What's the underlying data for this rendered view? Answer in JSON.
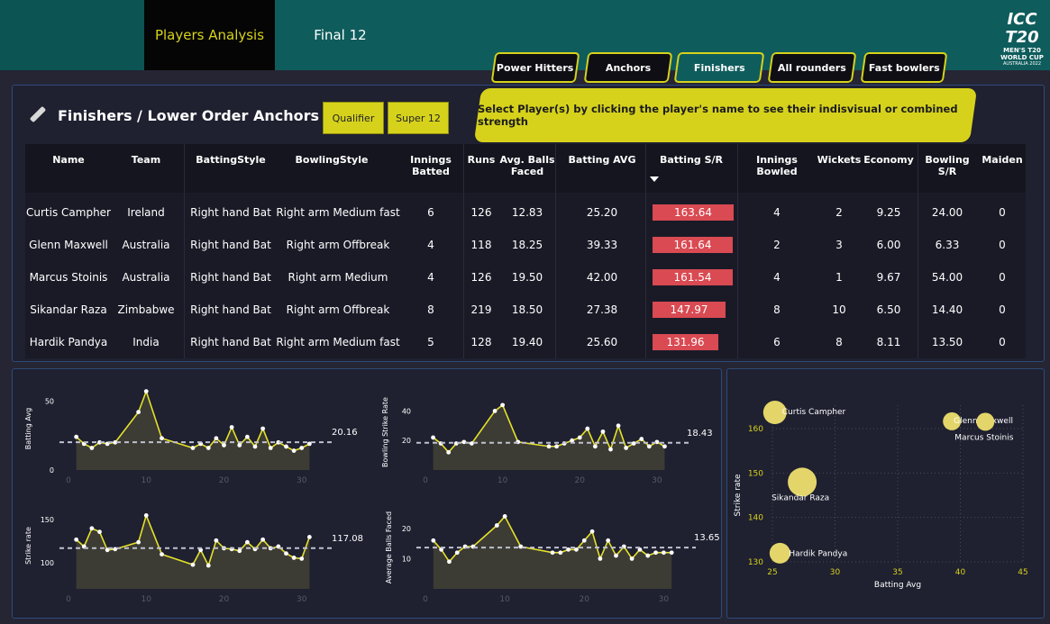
{
  "nav": {
    "tab_players": "Players Analysis",
    "tab_final": "Final 12"
  },
  "logo": {
    "top": "ICC T20",
    "line1": "MEN'S T20",
    "line2": "WORLD CUP",
    "line3": "AUSTRALIA 2022"
  },
  "categories": [
    "Power Hitters",
    "Anchors",
    "Finishers",
    "All rounders",
    "Fast bowlers"
  ],
  "active_category": "Finishers",
  "section_title": "Finishers / Lower Order Anchors",
  "stages": [
    "Qualifier",
    "Super 12"
  ],
  "banner": "Select Player(s) by clicking the player's name to see their indisvisual or combined strength",
  "table": {
    "headers": [
      "Name",
      "Team",
      "BattingStyle",
      "BowlingStyle",
      "Innings Batted",
      "Runs",
      "Avg. Balls Faced",
      "Batting AVG",
      "Batting S/R",
      "Innings Bowled",
      "Wickets",
      "Economy",
      "Bowling S/R",
      "Maiden"
    ],
    "rows": [
      [
        "Curtis Campher",
        "Ireland",
        "Right hand Bat",
        "Right arm Medium fast",
        "6",
        "126",
        "12.83",
        "25.20",
        "163.64",
        "4",
        "2",
        "9.25",
        "24.00",
        "0"
      ],
      [
        "Glenn Maxwell",
        "Australia",
        "Right hand Bat",
        "Right arm Offbreak",
        "4",
        "118",
        "18.25",
        "39.33",
        "161.64",
        "2",
        "3",
        "6.00",
        "6.33",
        "0"
      ],
      [
        "Marcus Stoinis",
        "Australia",
        "Right hand Bat",
        "Right arm Medium",
        "4",
        "126",
        "19.50",
        "42.00",
        "161.54",
        "4",
        "1",
        "9.67",
        "54.00",
        "0"
      ],
      [
        "Sikandar Raza",
        "Zimbabwe",
        "Right hand Bat",
        "Right arm Offbreak",
        "8",
        "219",
        "18.50",
        "27.38",
        "147.97",
        "8",
        "10",
        "6.50",
        "14.40",
        "0"
      ],
      [
        "Hardik Pandya",
        "India",
        "Right hand Bat",
        "Right arm Medium fast",
        "5",
        "128",
        "19.40",
        "25.60",
        "131.96",
        "6",
        "8",
        "8.11",
        "13.50",
        "0"
      ]
    ],
    "sr_bar_color": "#d94a52"
  },
  "colors": {
    "accent": "#d6d21c",
    "teal": "#0f5c5c",
    "bg": "#252534",
    "panel": "#1f2030"
  },
  "chart_data": [
    {
      "type": "line",
      "ylabel": "Batting Avg",
      "x": [
        1,
        2,
        3,
        4,
        5,
        6,
        9,
        10,
        12,
        16,
        17,
        18,
        19,
        20,
        21,
        22,
        23,
        24,
        25,
        26,
        27,
        28,
        29,
        30,
        31
      ],
      "values": [
        24,
        19,
        16,
        20,
        19,
        20,
        42,
        57,
        23,
        16,
        19,
        16,
        23,
        18,
        31,
        18,
        24,
        17,
        30,
        16,
        20,
        17,
        14,
        16,
        19
      ],
      "yticks": [
        0,
        50
      ],
      "xticks": [
        0,
        10,
        20,
        30
      ],
      "ylim": [
        0,
        60
      ],
      "xlim": [
        0,
        32
      ],
      "ref_value": "20.16",
      "ref": 20.16
    },
    {
      "type": "line",
      "ylabel": "Bowling Strike Rate",
      "x": [
        1,
        2,
        3,
        4,
        5,
        6,
        9,
        10,
        12,
        16,
        17,
        18,
        19,
        20,
        21,
        22,
        23,
        24,
        25,
        26,
        27,
        28,
        29,
        30,
        31
      ],
      "values": [
        22,
        18,
        12,
        18,
        19,
        18,
        40,
        44,
        19,
        16,
        16,
        18,
        20,
        22,
        28,
        16,
        26,
        14,
        30,
        15,
        18,
        21,
        16,
        19,
        16
      ],
      "yticks": [
        20,
        40
      ],
      "xticks": [
        0,
        10,
        20,
        30
      ],
      "ylim": [
        0,
        50
      ],
      "xlim": [
        0,
        32
      ],
      "ref_value": "18.43",
      "ref": 18.43
    },
    {
      "type": "line",
      "ylabel": "Strike rate",
      "x": [
        1,
        2,
        3,
        4,
        5,
        6,
        9,
        10,
        12,
        16,
        17,
        18,
        19,
        20,
        21,
        22,
        23,
        24,
        25,
        26,
        27,
        28,
        29,
        30,
        31
      ],
      "values": [
        127,
        119,
        140,
        136,
        115,
        116,
        124,
        155,
        110,
        98,
        115,
        97,
        126,
        117,
        116,
        114,
        124,
        116,
        127,
        117,
        119,
        111,
        106,
        105,
        130
      ],
      "yticks": [
        100,
        150
      ],
      "xticks": [
        0,
        10,
        20,
        30
      ],
      "ylim": [
        70,
        170
      ],
      "xlim": [
        0,
        32
      ],
      "ref_value": "117.08",
      "ref": 117.08
    },
    {
      "type": "line",
      "ylabel": "Average Balls Faced",
      "x": [
        1,
        2,
        3,
        4,
        5,
        6,
        9,
        10,
        12,
        16,
        17,
        18,
        19,
        20,
        21,
        22,
        23,
        24,
        25,
        26,
        27,
        28,
        29,
        30,
        31
      ],
      "values": [
        16,
        13,
        9,
        12,
        14,
        14,
        21,
        24,
        14,
        12,
        12,
        13,
        13,
        16,
        19,
        10,
        16,
        11,
        14,
        10,
        13,
        11,
        12,
        12,
        12
      ],
      "yticks": [
        10,
        20
      ],
      "xticks": [
        0,
        10,
        20,
        30
      ],
      "ylim": [
        0,
        28
      ],
      "xlim": [
        0,
        32
      ],
      "ref_value": "13.65",
      "ref": 13.65
    },
    {
      "type": "scatter",
      "xlabel": "Batting Avg",
      "ylabel": "Strike rate",
      "xlim": [
        25,
        45
      ],
      "ylim": [
        130,
        165
      ],
      "xticks": [
        25,
        30,
        35,
        40,
        45
      ],
      "yticks": [
        130,
        140,
        150,
        160
      ],
      "points": [
        {
          "name": "Curtis Campher",
          "x": 25.2,
          "y": 163.64,
          "size": 6
        },
        {
          "name": "Glenn Maxwell",
          "x": 39.33,
          "y": 161.64,
          "size": 4
        },
        {
          "name": "Marcus Stoinis",
          "x": 42.0,
          "y": 161.54,
          "size": 4
        },
        {
          "name": "Sikandar Raza",
          "x": 27.38,
          "y": 147.97,
          "size": 8
        },
        {
          "name": "Hardik Pandya",
          "x": 25.6,
          "y": 131.96,
          "size": 5
        }
      ]
    }
  ]
}
